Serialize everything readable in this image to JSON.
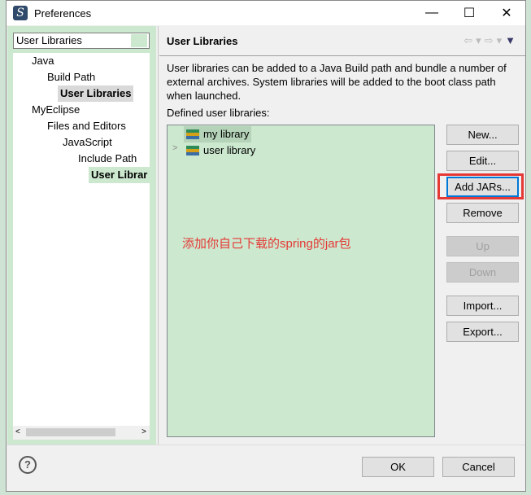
{
  "window": {
    "title": "Preferences",
    "minimize": "—",
    "maximize": "☐",
    "close": "✕"
  },
  "filter": {
    "value": "User Libraries"
  },
  "tree": [
    {
      "label": "Java"
    },
    {
      "label": "Build Path"
    },
    {
      "label": "User Libraries"
    },
    {
      "label": "MyEclipse"
    },
    {
      "label": "Files and Editors"
    },
    {
      "label": "JavaScript"
    },
    {
      "label": "Include Path"
    },
    {
      "label": "User Librar"
    }
  ],
  "page": {
    "title": "User Libraries",
    "description": "User libraries can be added to a Java Build path and bundle a number of external archives. System libraries will be added to the boot class path when launched.",
    "defined_label": "Defined user libraries:",
    "libraries": [
      {
        "label": "my library"
      },
      {
        "label": "user library"
      }
    ],
    "annotation": "添加你自己下载的spring的jar包",
    "buttons": {
      "new": "New...",
      "edit": "Edit...",
      "add_jars": "Add JARs...",
      "remove": "Remove",
      "up": "Up",
      "down": "Down",
      "import": "Import...",
      "export": "Export..."
    }
  },
  "footer": {
    "ok": "OK",
    "cancel": "Cancel",
    "help": "?"
  },
  "colors": {
    "accent_green": "#cce8cf",
    "highlight_red": "#e53935",
    "focus_blue": "#0078d7"
  }
}
